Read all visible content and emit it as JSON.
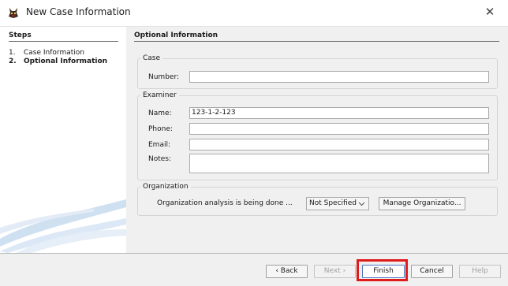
{
  "window": {
    "title": "New Case Information",
    "app_icon": "app-logo-icon",
    "close_glyph": "✕"
  },
  "steps": {
    "heading": "Steps",
    "items": [
      {
        "num": "1.",
        "label": "Case Information",
        "active": false
      },
      {
        "num": "2.",
        "label": "Optional Information",
        "active": true
      }
    ]
  },
  "panel": {
    "heading": "Optional Information",
    "case": {
      "legend": "Case",
      "number_label": "Number:",
      "number_value": ""
    },
    "examiner": {
      "legend": "Examiner",
      "name_label": "Name:",
      "name_value": "123-1-2-123",
      "phone_label": "Phone:",
      "phone_value": "",
      "email_label": "Email:",
      "email_value": "",
      "notes_label": "Notes:",
      "notes_value": ""
    },
    "organization": {
      "legend": "Organization",
      "text": "Organization analysis is being done ...",
      "selected": "Not Specified",
      "manage_label": "Manage Organizatio..."
    }
  },
  "buttons": {
    "back": "Back",
    "next": "Next",
    "finish": "Finish",
    "cancel": "Cancel",
    "help": "Help"
  },
  "colors": {
    "highlight": "#e01b1b",
    "focus_border": "#4a74c0",
    "sidebar_bg": "#ffffff",
    "dialog_bg": "#f0f0f0"
  }
}
